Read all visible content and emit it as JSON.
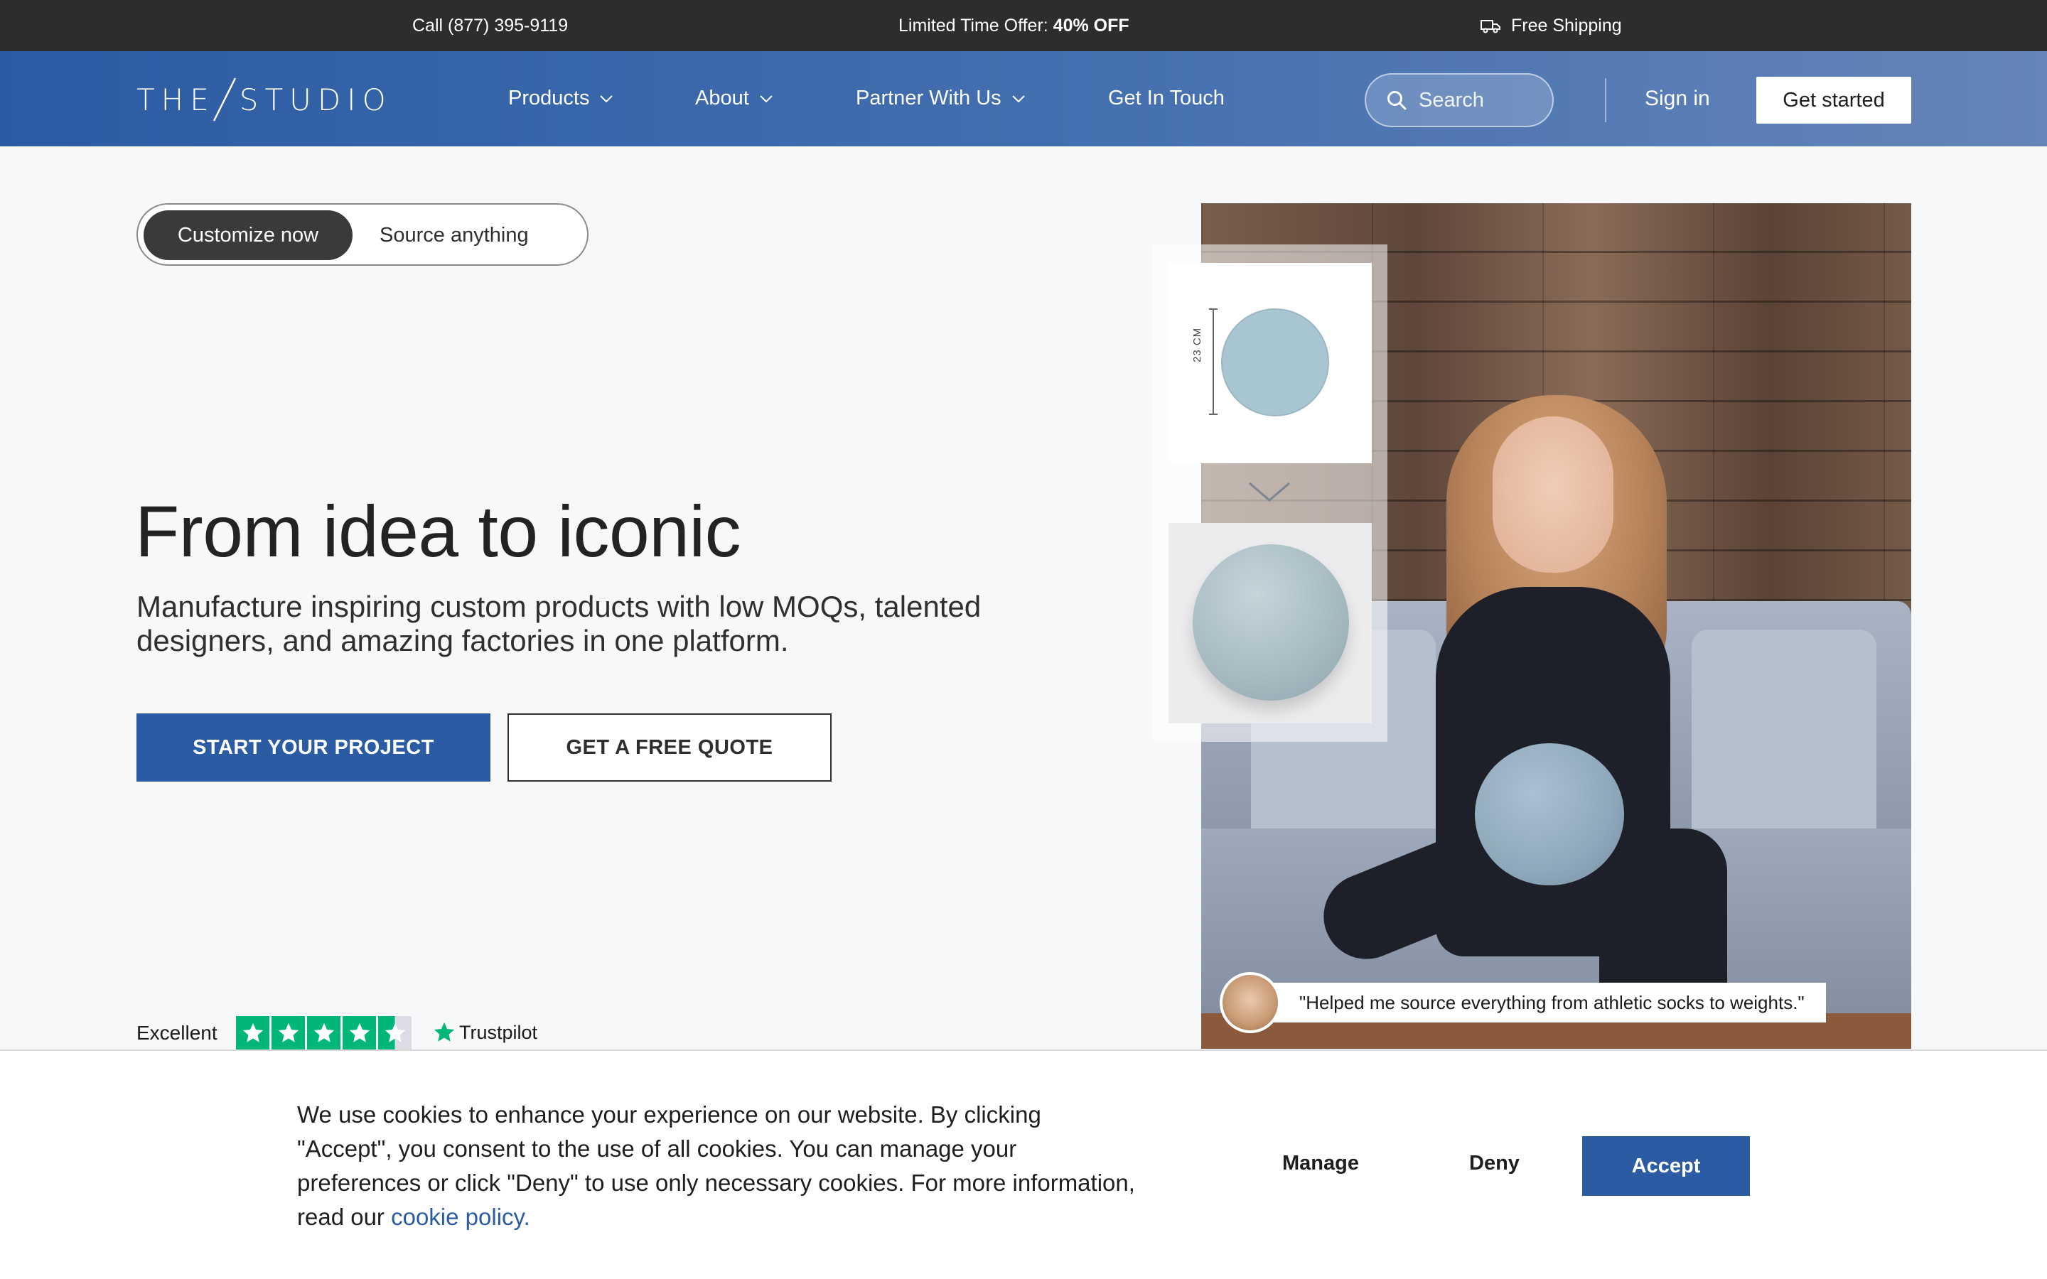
{
  "topbar": {
    "call": "Call (877) 395-9119",
    "offer_prefix": "Limited Time Offer: ",
    "offer_highlight": "40% OFF",
    "shipping": "Free Shipping"
  },
  "header": {
    "logo_left": "THE",
    "logo_right": "STUDIO",
    "nav": [
      {
        "label": "Products"
      },
      {
        "label": "About"
      },
      {
        "label": "Partner With Us"
      },
      {
        "label": "Get In Touch"
      }
    ],
    "search_placeholder": "Search",
    "sign_in": "Sign in",
    "get_started": "Get started"
  },
  "toggle": {
    "active": "Customize now",
    "inactive": "Source anything"
  },
  "hero": {
    "title": "From idea to iconic",
    "subtitle": "Manufacture inspiring custom products with low MOQs, talented designers, and amazing factories in one platform.",
    "cta_primary": "START YOUR PROJECT",
    "cta_secondary": "GET A FREE QUOTE"
  },
  "trustpilot": {
    "rating_word": "Excellent",
    "stars": 4.5,
    "brand": "Trustpilot"
  },
  "product_card": {
    "dimension": "23 CM"
  },
  "testimonial": {
    "quote": "\"Helped me source everything from athletic socks to weights.\""
  },
  "cookie": {
    "text": "We use cookies to enhance your experience on our website. By clicking \"Accept\", you consent to the use of all cookies. You can manage your preferences or click \"Deny\" to use only necessary cookies. For more information, read our ",
    "link": "cookie policy.",
    "manage": "Manage",
    "deny": "Deny",
    "accept": "Accept"
  },
  "colors": {
    "brand_blue": "#2b5ba3",
    "topbar_bg": "#2d2d2d",
    "trustpilot_green": "#00b67a"
  }
}
